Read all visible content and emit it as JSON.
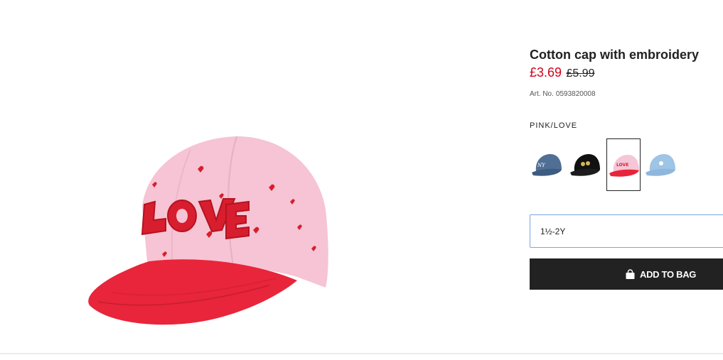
{
  "product": {
    "title": "Cotton cap with embroidery",
    "price_sale": "£3.69",
    "price_original": "£5.99",
    "art_label": "Art. No.",
    "art_number": "0593820008",
    "image_alt": "Pink cotton cap with red brim and LOVE embroidery",
    "embroidery_text": "LOVE"
  },
  "color": {
    "selected_label": "PINK/LOVE",
    "swatches": [
      {
        "name": "blue cap",
        "icon": "cap-thumbnail-icon",
        "body": "#4f6f95",
        "brim": "#3e5c80",
        "selected": false
      },
      {
        "name": "black cap",
        "icon": "cap-thumbnail-icon",
        "body": "#111111",
        "brim": "#1c1c1c",
        "selected": false
      },
      {
        "name": "pink/love cap",
        "icon": "cap-thumbnail-icon",
        "body": "#f4c6d6",
        "brim": "#e8243a",
        "selected": true
      },
      {
        "name": "light blue cap",
        "icon": "cap-thumbnail-icon",
        "body": "#9ec4e6",
        "brim": "#8fb7dc",
        "selected": false
      }
    ]
  },
  "size": {
    "selected": "1½-2Y"
  },
  "actions": {
    "add_to_bag": "ADD TO BAG"
  },
  "colors": {
    "sale_red": "#d0021b",
    "button_bg": "#222222",
    "select_border": "#7aa4e4"
  }
}
